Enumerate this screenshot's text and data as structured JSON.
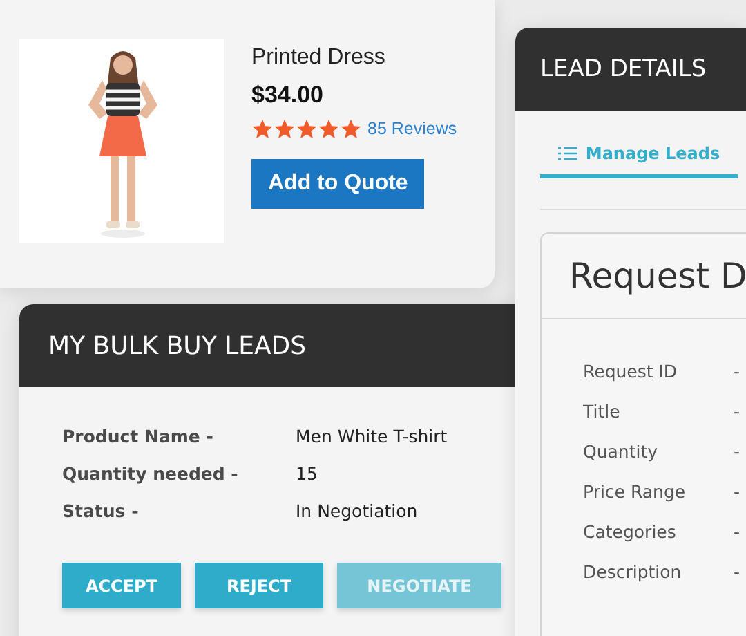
{
  "product": {
    "name": "Printed Dress",
    "price": "$34.00",
    "stars": 5,
    "reviews": "85 Reviews",
    "button": "Add to Quote"
  },
  "bulk_leads": {
    "title": "MY BULK BUY LEADS",
    "fields": [
      {
        "label": "Product Name -",
        "value": "Men White T-shirt"
      },
      {
        "label": "Quantity needed -",
        "value": "15"
      },
      {
        "label": "Status -",
        "value": "In Negotiation"
      }
    ],
    "buttons": [
      {
        "label": "ACCEPT",
        "disabled": false
      },
      {
        "label": "REJECT",
        "disabled": false
      },
      {
        "label": "NEGOTIATE",
        "disabled": true
      }
    ]
  },
  "lead_details": {
    "title": "LEAD DETAILS",
    "tabs": [
      {
        "label": "Manage Leads",
        "selected": true
      }
    ],
    "panel_title": "Request D",
    "fields": [
      {
        "label": "Request ID",
        "value": "-"
      },
      {
        "label": "Title",
        "value": "-"
      },
      {
        "label": "Quantity",
        "value": "-"
      },
      {
        "label": "Price Range",
        "value": "-"
      },
      {
        "label": "Categories",
        "value": "-"
      },
      {
        "label": "Description",
        "value": "-"
      }
    ]
  }
}
